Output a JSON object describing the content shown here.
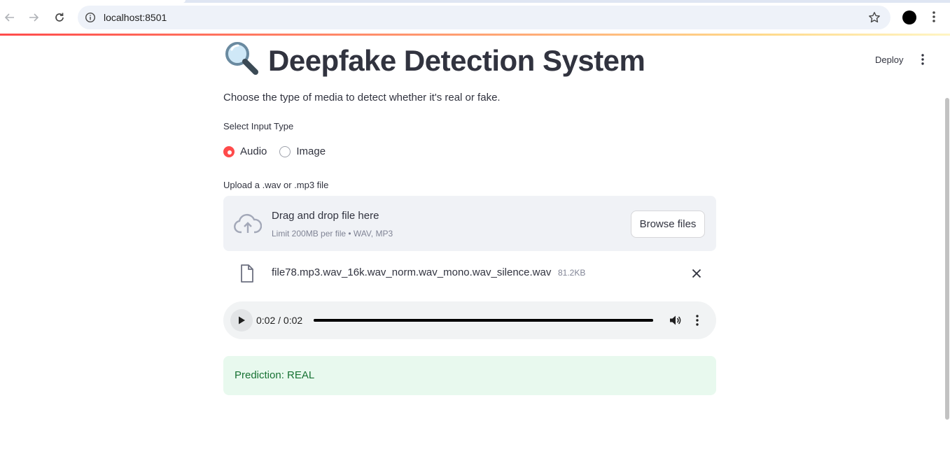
{
  "browser": {
    "url": "localhost:8501"
  },
  "header": {
    "deploy_label": "Deploy"
  },
  "main": {
    "title": "Deepfake Detection System",
    "subtitle": "Choose the type of media to detect whether it's real or fake.",
    "input_type": {
      "label": "Select Input Type",
      "options": [
        {
          "label": "Audio",
          "selected": true
        },
        {
          "label": "Image",
          "selected": false
        }
      ]
    },
    "uploader": {
      "label": "Upload a .wav or .mp3 file",
      "drop_title": "Drag and drop file here",
      "drop_limit": "Limit 200MB per file • WAV, MP3",
      "browse_label": "Browse files"
    },
    "file": {
      "name": "file78.mp3.wav_16k.wav_norm.wav_mono.wav_silence.wav",
      "size": "81.2KB"
    },
    "player": {
      "time": "0:02 / 0:02",
      "progress": 1.0
    },
    "prediction": {
      "text": "Prediction: REAL"
    }
  },
  "colors": {
    "accent": "#ff4b4b",
    "success_bg": "#e8f9ee",
    "success_text": "#177233",
    "text": "#31333f"
  },
  "icons": {
    "back": "arrow-left-icon",
    "forward": "arrow-right-icon",
    "reload": "reload-icon",
    "info": "info-icon",
    "bookmark": "star-icon",
    "title": "magnifier-icon",
    "upload": "cloud-upload-icon",
    "file": "file-icon",
    "remove": "close-icon",
    "play": "play-icon",
    "volume": "volume-icon",
    "more": "more-vertical-icon"
  }
}
